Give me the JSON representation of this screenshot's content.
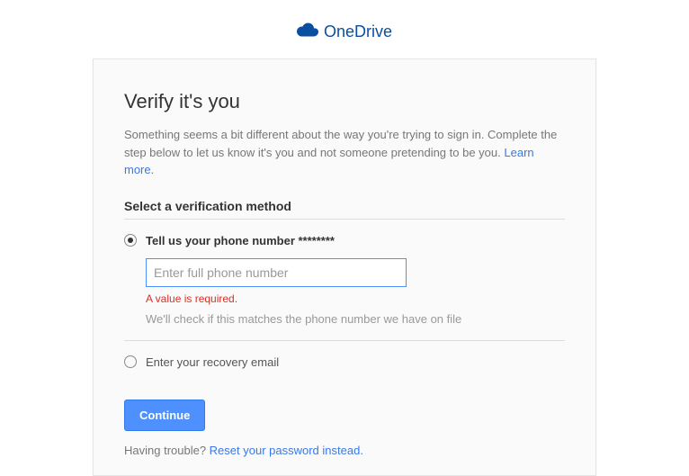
{
  "logo": {
    "text": "OneDrive"
  },
  "card": {
    "title": "Verify it's you",
    "subtitle": "Something seems a bit different about the way you're trying to sign in. Complete the step below to let us know it's you and not someone pretending to be you. ",
    "learn_more": "Learn more.",
    "method_heading": "Select a verification method",
    "options": {
      "phone": {
        "label": "Tell us your phone number ********",
        "placeholder": "Enter full phone number",
        "value": "",
        "error": "A value is required.",
        "hint": "We'll check if this matches the phone number we have on file"
      },
      "email": {
        "label": "Enter your recovery email"
      }
    },
    "continue": "Continue",
    "trouble": {
      "text": "Having trouble? ",
      "link": "Reset your password instead."
    }
  }
}
